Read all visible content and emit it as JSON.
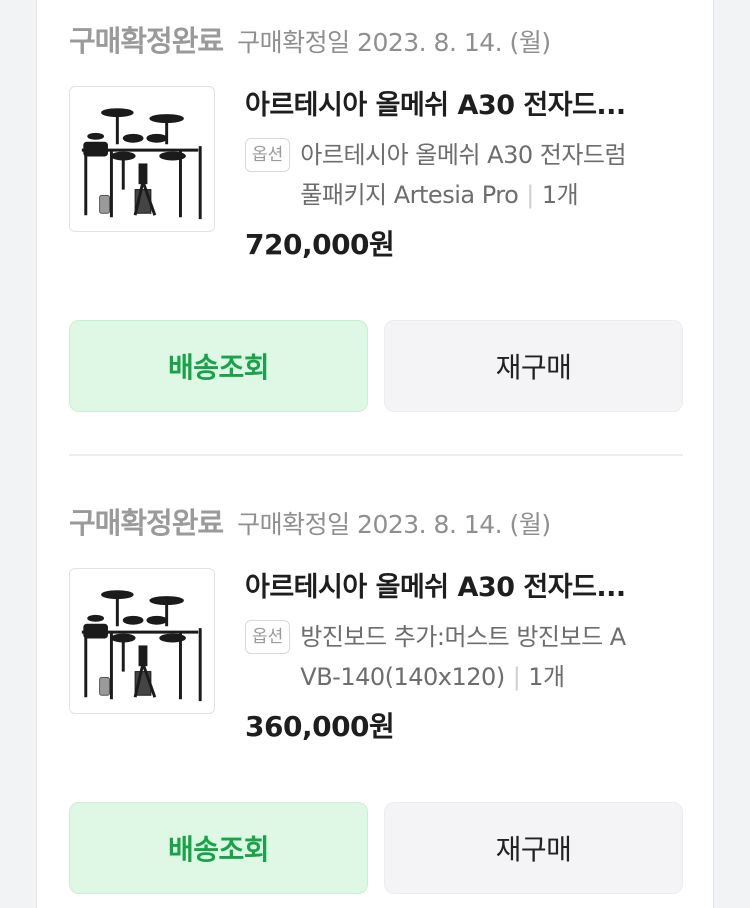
{
  "orders": [
    {
      "status": "구매확정완료",
      "date": "구매확정일 2023. 8. 14. (월)",
      "title": "아르테시아 올메쉬 A30 전자드...",
      "option_badge": "옵션",
      "option_line1": "아르테시아 올메쉬 A30 전자드럼",
      "option_line2": "풀패키지 Artesia Pro",
      "separator": "|",
      "quantity": "1개",
      "price": "720,000원",
      "track_label": "배송조회",
      "rebuy_label": "재구매",
      "image_icon": "electronic-drum-kit"
    },
    {
      "status": "구매확정완료",
      "date": "구매확정일 2023. 8. 14. (월)",
      "title": "아르테시아 올메쉬 A30 전자드...",
      "option_badge": "옵션",
      "option_line1": "방진보드 추가:머스트 방진보드 A",
      "option_line2": "VB-140(140x120)",
      "separator": "|",
      "quantity": "1개",
      "price": "360,000원",
      "track_label": "배송조회",
      "rebuy_label": "재구매",
      "image_icon": "electronic-drum-kit"
    }
  ],
  "colors": {
    "track_bg": "#dff8e6",
    "track_text": "#17a348",
    "rebuy_bg": "#f4f4f6"
  }
}
